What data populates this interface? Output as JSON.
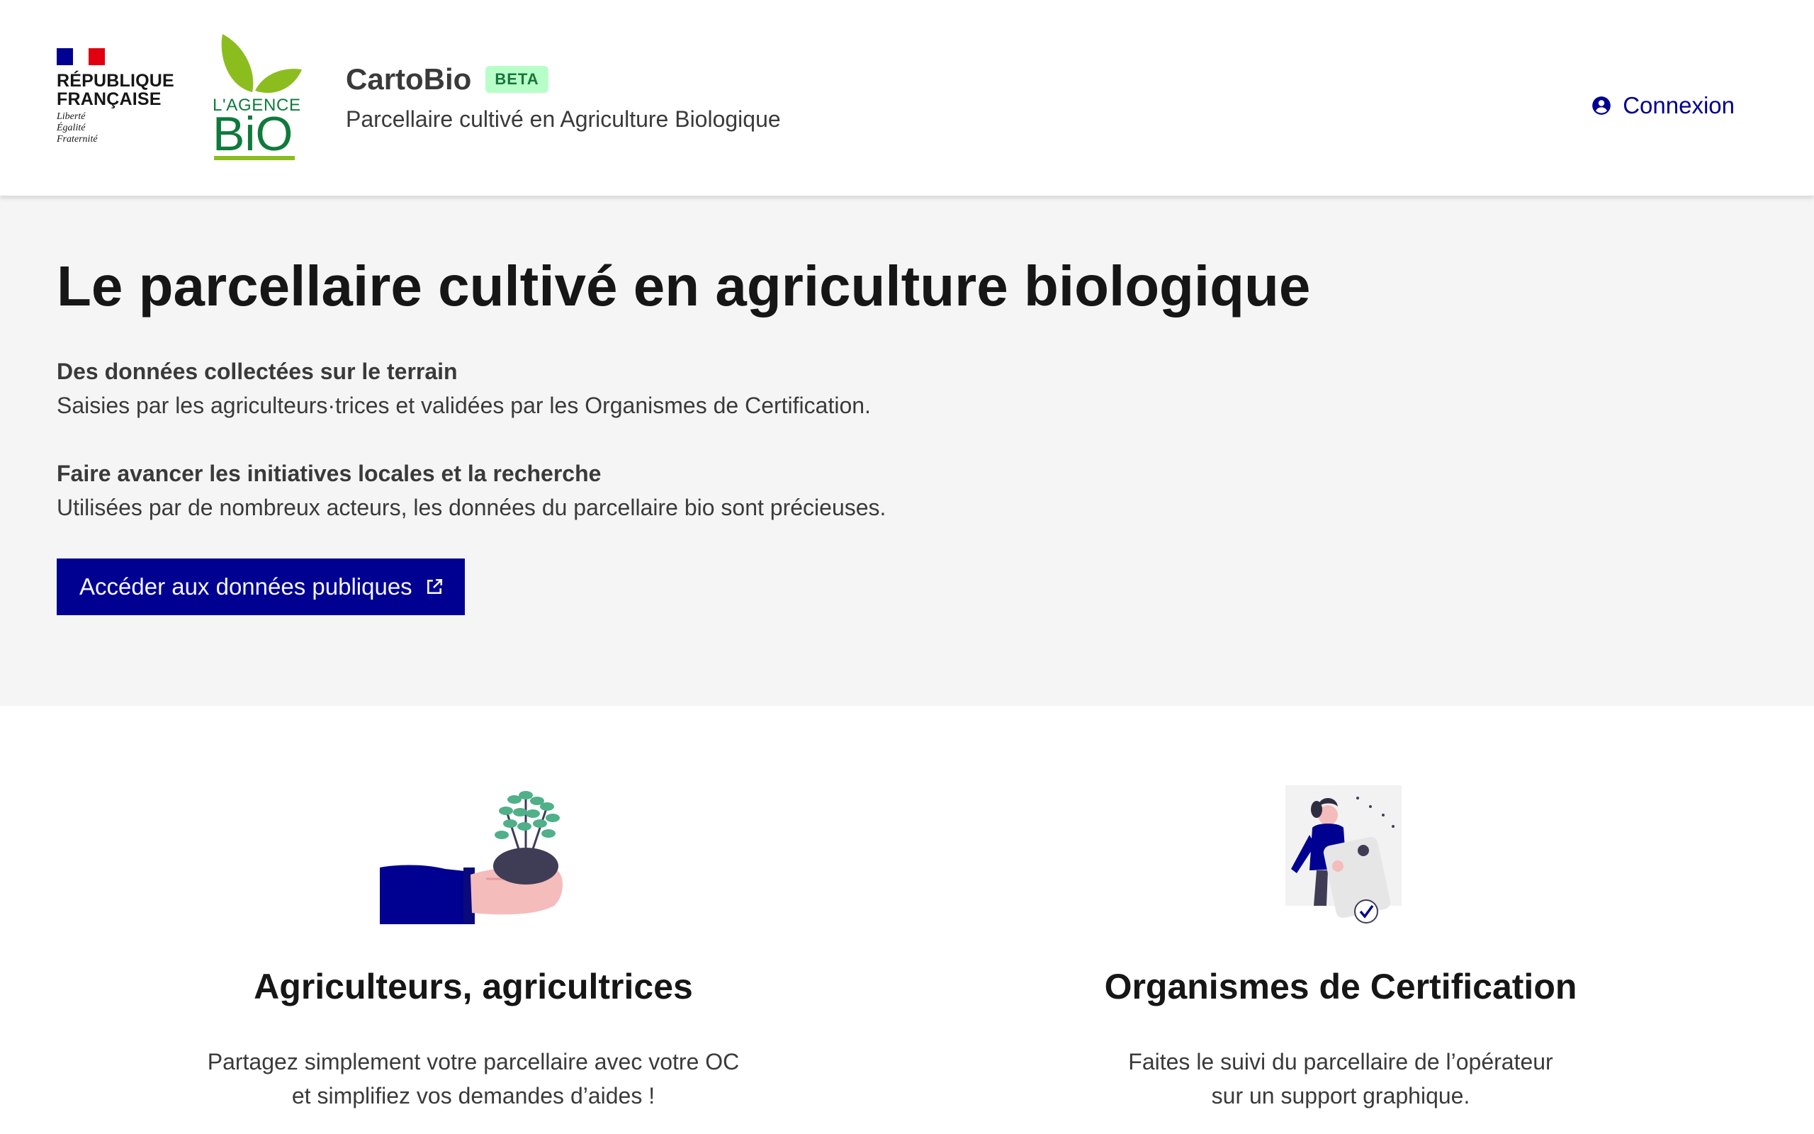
{
  "header": {
    "republic": {
      "line1": "RÉPUBLIQUE",
      "line2": "FRANÇAISE",
      "motto": [
        "Liberté",
        "Égalité",
        "Fraternité"
      ]
    },
    "agency_logo": {
      "line1": "L'AGENCE",
      "line2": "BiO"
    },
    "service_title": "CartoBio",
    "badge": "BETA",
    "tagline": "Parcellaire cultivé en Agriculture Biologique",
    "login_label": "Connexion"
  },
  "hero": {
    "title": "Le parcellaire cultivé en agriculture biologique",
    "blocks": [
      {
        "heading": "Des données collectées sur le terrain",
        "text": "Saisies par les agriculteurs·trices et validées par les Organismes de Certification."
      },
      {
        "heading": "Faire avancer les initiatives locales et la recherche",
        "text": "Utilisées par de nombreux acteurs, les données du parcellaire bio sont précieuses."
      }
    ],
    "cta_label": "Accéder aux données publiques"
  },
  "profiles": [
    {
      "title": "Agriculteurs, agricultrices",
      "lines": [
        "Partagez simplement votre parcellaire avec votre OC",
        "et simplifiez vos demandes d’aides !"
      ]
    },
    {
      "title": "Organismes de Certification",
      "lines": [
        "Faites le suivi du parcellaire de l’opérateur",
        "sur un support graphique."
      ]
    }
  ],
  "colors": {
    "primary": "#000091",
    "hero_bg": "#f5f5f5",
    "badge_bg": "#b8fec9",
    "badge_text": "#18753c",
    "agency_green": "#8cbd1f",
    "agency_dark_green": "#0e7a3b",
    "flag_red": "#e1000f"
  },
  "icons": {
    "login": "user-circle-icon",
    "cta": "external-link-icon"
  }
}
